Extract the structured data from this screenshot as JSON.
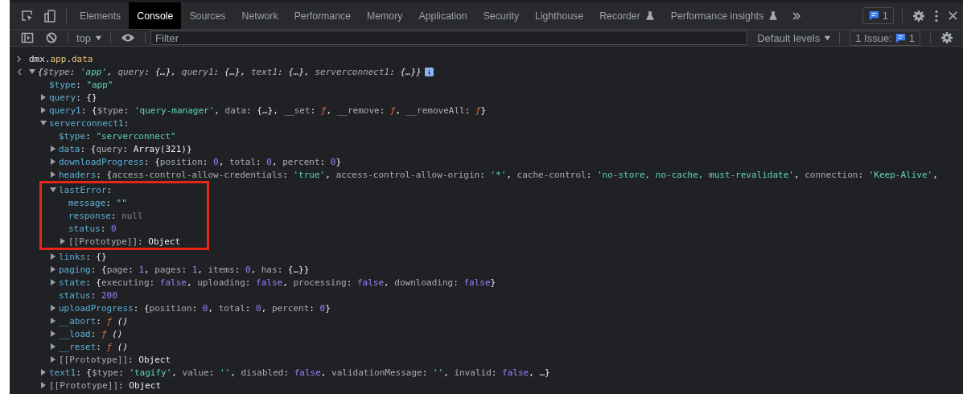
{
  "toolbar": {
    "tabs": [
      {
        "label": "Elements",
        "selected": false,
        "experimental": false
      },
      {
        "label": "Console",
        "selected": true,
        "experimental": false
      },
      {
        "label": "Sources",
        "selected": false,
        "experimental": false
      },
      {
        "label": "Network",
        "selected": false,
        "experimental": false
      },
      {
        "label": "Performance",
        "selected": false,
        "experimental": false
      },
      {
        "label": "Memory",
        "selected": false,
        "experimental": false
      },
      {
        "label": "Application",
        "selected": false,
        "experimental": false
      },
      {
        "label": "Security",
        "selected": false,
        "experimental": false
      },
      {
        "label": "Lighthouse",
        "selected": false,
        "experimental": false
      },
      {
        "label": "Recorder",
        "selected": false,
        "experimental": true
      },
      {
        "label": "Performance insights",
        "selected": false,
        "experimental": true
      }
    ],
    "issues_badge": "1"
  },
  "console_toolbar": {
    "context": "top",
    "filter": {
      "placeholder": "Filter"
    },
    "levels": "Default levels",
    "issues_label": "1 Issue:",
    "issues_count": "1"
  },
  "console": {
    "input": [
      {
        "kind": "plain",
        "text": "dmx."
      },
      {
        "kind": "global",
        "text": "app"
      },
      {
        "kind": "plain",
        "text": "."
      },
      {
        "kind": "global",
        "text": "data"
      }
    ],
    "result": {
      "expanded": true,
      "summary": [
        {
          "kind": "punct",
          "text": "{"
        },
        {
          "kind": "prop",
          "text": "$type"
        },
        {
          "kind": "punct",
          "text": ": "
        },
        {
          "kind": "string",
          "text": "'app'"
        },
        {
          "kind": "punct",
          "text": ", "
        },
        {
          "kind": "prop",
          "text": "query"
        },
        {
          "kind": "punct",
          "text": ": {…}, "
        },
        {
          "kind": "prop",
          "text": "query1"
        },
        {
          "kind": "punct",
          "text": ": {…}, "
        },
        {
          "kind": "prop",
          "text": "text1"
        },
        {
          "kind": "punct",
          "text": ": {…}, "
        },
        {
          "kind": "prop",
          "text": "serverconnect1"
        },
        {
          "kind": "punct",
          "text": ": {…}}"
        }
      ],
      "children": [
        {
          "key": "$type",
          "kind": "property",
          "value": [
            {
              "kind": "punct",
              "text": ": "
            },
            {
              "kind": "string",
              "text": "\"app\""
            }
          ]
        },
        {
          "key": "query",
          "kind": "property",
          "expanded": false,
          "value": [
            {
              "kind": "punct",
              "text": ": {}"
            }
          ]
        },
        {
          "key": "query1",
          "kind": "property",
          "expanded": false,
          "value": [
            {
              "kind": "punct",
              "text": ": {"
            },
            {
              "kind": "prop",
              "text": "$type"
            },
            {
              "kind": "punct",
              "text": ": "
            },
            {
              "kind": "string",
              "text": "'query-manager'"
            },
            {
              "kind": "punct",
              "text": ", "
            },
            {
              "kind": "prop",
              "text": "data"
            },
            {
              "kind": "punct",
              "text": ": {…}, "
            },
            {
              "kind": "prop",
              "text": "__set"
            },
            {
              "kind": "punct",
              "text": ": "
            },
            {
              "kind": "function",
              "text": "ƒ"
            },
            {
              "kind": "punct",
              "text": ", "
            },
            {
              "kind": "prop",
              "text": "__remove"
            },
            {
              "kind": "punct",
              "text": ": "
            },
            {
              "kind": "function",
              "text": "ƒ"
            },
            {
              "kind": "punct",
              "text": ", "
            },
            {
              "kind": "prop",
              "text": "__removeAll"
            },
            {
              "kind": "punct",
              "text": ": "
            },
            {
              "kind": "function",
              "text": "ƒ"
            },
            {
              "kind": "punct",
              "text": "}"
            }
          ]
        },
        {
          "key": "serverconnect1",
          "kind": "property",
          "expanded": true,
          "value": [
            {
              "kind": "punct",
              "text": ":"
            }
          ],
          "children": [
            {
              "key": "$type",
              "kind": "property",
              "value": [
                {
                  "kind": "punct",
                  "text": ": "
                },
                {
                  "kind": "string",
                  "text": "\"serverconnect\""
                }
              ]
            },
            {
              "key": "data",
              "kind": "property",
              "expanded": false,
              "value": [
                {
                  "kind": "punct",
                  "text": ": {"
                },
                {
                  "kind": "prop",
                  "text": "query"
                },
                {
                  "kind": "punct",
                  "text": ": "
                },
                {
                  "kind": "object",
                  "text": "Array(321)"
                },
                {
                  "kind": "punct",
                  "text": "}"
                }
              ]
            },
            {
              "key": "downloadProgress",
              "kind": "property",
              "expanded": false,
              "value": [
                {
                  "kind": "punct",
                  "text": ": {"
                },
                {
                  "kind": "prop",
                  "text": "position"
                },
                {
                  "kind": "punct",
                  "text": ": "
                },
                {
                  "kind": "number",
                  "text": "0"
                },
                {
                  "kind": "punct",
                  "text": ", "
                },
                {
                  "kind": "prop",
                  "text": "total"
                },
                {
                  "kind": "punct",
                  "text": ": "
                },
                {
                  "kind": "number",
                  "text": "0"
                },
                {
                  "kind": "punct",
                  "text": ", "
                },
                {
                  "kind": "prop",
                  "text": "percent"
                },
                {
                  "kind": "punct",
                  "text": ": "
                },
                {
                  "kind": "number",
                  "text": "0"
                },
                {
                  "kind": "punct",
                  "text": "}"
                }
              ]
            },
            {
              "key": "headers",
              "kind": "property",
              "expanded": false,
              "value": [
                {
                  "kind": "punct",
                  "text": ": {"
                },
                {
                  "kind": "prop",
                  "text": "access-control-allow-credentials"
                },
                {
                  "kind": "punct",
                  "text": ": "
                },
                {
                  "kind": "string",
                  "text": "'true'"
                },
                {
                  "kind": "punct",
                  "text": ", "
                },
                {
                  "kind": "prop",
                  "text": "access-control-allow-origin"
                },
                {
                  "kind": "punct",
                  "text": ": "
                },
                {
                  "kind": "string",
                  "text": "'*'"
                },
                {
                  "kind": "punct",
                  "text": ", "
                },
                {
                  "kind": "prop",
                  "text": "cache-control"
                },
                {
                  "kind": "punct",
                  "text": ": "
                },
                {
                  "kind": "string",
                  "text": "'no-store, no-cache, must-revalidate'"
                },
                {
                  "kind": "punct",
                  "text": ", "
                },
                {
                  "kind": "prop",
                  "text": "connection"
                },
                {
                  "kind": "punct",
                  "text": ": "
                },
                {
                  "kind": "string",
                  "text": "'Keep-Alive'"
                },
                {
                  "kind": "punct",
                  "text": ","
                }
              ]
            },
            {
              "key": "lastError",
              "kind": "property",
              "expanded": true,
              "highlighted": true,
              "value": [
                {
                  "kind": "punct",
                  "text": ":"
                }
              ],
              "children": [
                {
                  "key": "message",
                  "kind": "property",
                  "value": [
                    {
                      "kind": "punct",
                      "text": ": "
                    },
                    {
                      "kind": "string",
                      "text": "\"\""
                    }
                  ]
                },
                {
                  "key": "response",
                  "kind": "property",
                  "value": [
                    {
                      "kind": "punct",
                      "text": ": "
                    },
                    {
                      "kind": "null",
                      "text": "null"
                    }
                  ]
                },
                {
                  "key": "status",
                  "kind": "property",
                  "value": [
                    {
                      "kind": "punct",
                      "text": ": "
                    },
                    {
                      "kind": "number",
                      "text": "0"
                    }
                  ]
                },
                {
                  "key": "[[Prototype]]",
                  "kind": "internal",
                  "expanded": false,
                  "value": [
                    {
                      "kind": "punct",
                      "text": ": "
                    },
                    {
                      "kind": "object",
                      "text": "Object"
                    }
                  ]
                }
              ]
            },
            {
              "key": "links",
              "kind": "property",
              "expanded": false,
              "value": [
                {
                  "kind": "punct",
                  "text": ": {}"
                }
              ]
            },
            {
              "key": "paging",
              "kind": "property",
              "expanded": false,
              "value": [
                {
                  "kind": "punct",
                  "text": ": {"
                },
                {
                  "kind": "prop",
                  "text": "page"
                },
                {
                  "kind": "punct",
                  "text": ": "
                },
                {
                  "kind": "number",
                  "text": "1"
                },
                {
                  "kind": "punct",
                  "text": ", "
                },
                {
                  "kind": "prop",
                  "text": "pages"
                },
                {
                  "kind": "punct",
                  "text": ": "
                },
                {
                  "kind": "number",
                  "text": "1"
                },
                {
                  "kind": "punct",
                  "text": ", "
                },
                {
                  "kind": "prop",
                  "text": "items"
                },
                {
                  "kind": "punct",
                  "text": ": "
                },
                {
                  "kind": "number",
                  "text": "0"
                },
                {
                  "kind": "punct",
                  "text": ", "
                },
                {
                  "kind": "prop",
                  "text": "has"
                },
                {
                  "kind": "punct",
                  "text": ": {…}}"
                }
              ]
            },
            {
              "key": "state",
              "kind": "property",
              "expanded": false,
              "value": [
                {
                  "kind": "punct",
                  "text": ": {"
                },
                {
                  "kind": "prop",
                  "text": "executing"
                },
                {
                  "kind": "punct",
                  "text": ": "
                },
                {
                  "kind": "number",
                  "text": "false"
                },
                {
                  "kind": "punct",
                  "text": ", "
                },
                {
                  "kind": "prop",
                  "text": "uploading"
                },
                {
                  "kind": "punct",
                  "text": ": "
                },
                {
                  "kind": "number",
                  "text": "false"
                },
                {
                  "kind": "punct",
                  "text": ", "
                },
                {
                  "kind": "prop",
                  "text": "processing"
                },
                {
                  "kind": "punct",
                  "text": ": "
                },
                {
                  "kind": "number",
                  "text": "false"
                },
                {
                  "kind": "punct",
                  "text": ", "
                },
                {
                  "kind": "prop",
                  "text": "downloading"
                },
                {
                  "kind": "punct",
                  "text": ": "
                },
                {
                  "kind": "number",
                  "text": "false"
                },
                {
                  "kind": "punct",
                  "text": "}"
                }
              ]
            },
            {
              "key": "status",
              "kind": "property",
              "value": [
                {
                  "kind": "punct",
                  "text": ": "
                },
                {
                  "kind": "number",
                  "text": "200"
                }
              ]
            },
            {
              "key": "uploadProgress",
              "kind": "property",
              "expanded": false,
              "value": [
                {
                  "kind": "punct",
                  "text": ": {"
                },
                {
                  "kind": "prop",
                  "text": "position"
                },
                {
                  "kind": "punct",
                  "text": ": "
                },
                {
                  "kind": "number",
                  "text": "0"
                },
                {
                  "kind": "punct",
                  "text": ", "
                },
                {
                  "kind": "prop",
                  "text": "total"
                },
                {
                  "kind": "punct",
                  "text": ": "
                },
                {
                  "kind": "number",
                  "text": "0"
                },
                {
                  "kind": "punct",
                  "text": ", "
                },
                {
                  "kind": "prop",
                  "text": "percent"
                },
                {
                  "kind": "punct",
                  "text": ": "
                },
                {
                  "kind": "number",
                  "text": "0"
                },
                {
                  "kind": "punct",
                  "text": "}"
                }
              ]
            },
            {
              "key": "__abort",
              "kind": "property",
              "expanded": false,
              "value": [
                {
                  "kind": "punct",
                  "text": ": "
                },
                {
                  "kind": "function",
                  "text": "ƒ"
                },
                {
                  "kind": "fnargs",
                  "text": " ()"
                }
              ]
            },
            {
              "key": "__load",
              "kind": "property",
              "expanded": false,
              "value": [
                {
                  "kind": "punct",
                  "text": ": "
                },
                {
                  "kind": "function",
                  "text": "ƒ"
                },
                {
                  "kind": "fnargs",
                  "text": " ()"
                }
              ]
            },
            {
              "key": "__reset",
              "kind": "property",
              "expanded": false,
              "value": [
                {
                  "kind": "punct",
                  "text": ": "
                },
                {
                  "kind": "function",
                  "text": "ƒ"
                },
                {
                  "kind": "fnargs",
                  "text": " ()"
                }
              ]
            },
            {
              "key": "[[Prototype]]",
              "kind": "internal",
              "expanded": false,
              "value": [
                {
                  "kind": "punct",
                  "text": ": "
                },
                {
                  "kind": "object",
                  "text": "Object"
                }
              ]
            }
          ]
        },
        {
          "key": "text1",
          "kind": "property",
          "expanded": false,
          "value": [
            {
              "kind": "punct",
              "text": ": {"
            },
            {
              "kind": "prop",
              "text": "$type"
            },
            {
              "kind": "punct",
              "text": ": "
            },
            {
              "kind": "string",
              "text": "'tagify'"
            },
            {
              "kind": "punct",
              "text": ", "
            },
            {
              "kind": "prop",
              "text": "value"
            },
            {
              "kind": "punct",
              "text": ": "
            },
            {
              "kind": "string",
              "text": "''"
            },
            {
              "kind": "punct",
              "text": ", "
            },
            {
              "kind": "prop",
              "text": "disabled"
            },
            {
              "kind": "punct",
              "text": ": "
            },
            {
              "kind": "number",
              "text": "false"
            },
            {
              "kind": "punct",
              "text": ", "
            },
            {
              "kind": "prop",
              "text": "validationMessage"
            },
            {
              "kind": "punct",
              "text": ": "
            },
            {
              "kind": "string",
              "text": "''"
            },
            {
              "kind": "punct",
              "text": ", "
            },
            {
              "kind": "prop",
              "text": "invalid"
            },
            {
              "kind": "punct",
              "text": ": "
            },
            {
              "kind": "number",
              "text": "false"
            },
            {
              "kind": "punct",
              "text": ", …}"
            }
          ]
        },
        {
          "key": "[[Prototype]]",
          "kind": "internal",
          "expanded": false,
          "value": [
            {
              "kind": "punct",
              "text": ": "
            },
            {
              "kind": "object",
              "text": "Object"
            }
          ]
        }
      ]
    }
  }
}
